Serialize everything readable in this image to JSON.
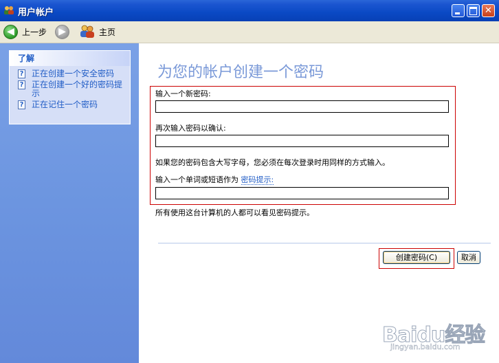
{
  "window": {
    "title": "用户帐户"
  },
  "toolbar": {
    "back_label": "上一步",
    "home_label": "主页"
  },
  "sidebar": {
    "heading": "了解",
    "items": [
      {
        "label": "正在创建一个安全密码"
      },
      {
        "label": "正在创建一个好的密码提示"
      },
      {
        "label": "正在记住一个密码"
      }
    ]
  },
  "main": {
    "title": "为您的帐户创建一个密码",
    "new_password_label": "输入一个新密码:",
    "confirm_label": "再次输入密码以确认:",
    "case_note": "如果您的密码包含大写字母，您必须在每次登录时用同样的方式输入。",
    "hint_prefix": "输入一个单词或短语作为",
    "hint_link": "密码提示:",
    "visibility_note": "所有使用这台计算机的人都可以看见密码提示。",
    "new_password_value": "",
    "confirm_value": "",
    "hint_value": "",
    "create_button": "创建密码(C)",
    "cancel_button": "取消"
  },
  "watermark": {
    "brand": "Baidu经验",
    "url": "jingyan.baidu.com"
  },
  "colors": {
    "titlebar": "#0a49c4",
    "sidebar": "#6c95e0",
    "link": "#215dc6",
    "heading": "#7a99d8",
    "highlight": "#cc0000"
  },
  "icons": [
    "user-accounts-icon",
    "minimize-icon",
    "maximize-icon",
    "close-icon",
    "back-arrow-icon",
    "forward-arrow-icon",
    "users-home-icon",
    "help-icon"
  ]
}
